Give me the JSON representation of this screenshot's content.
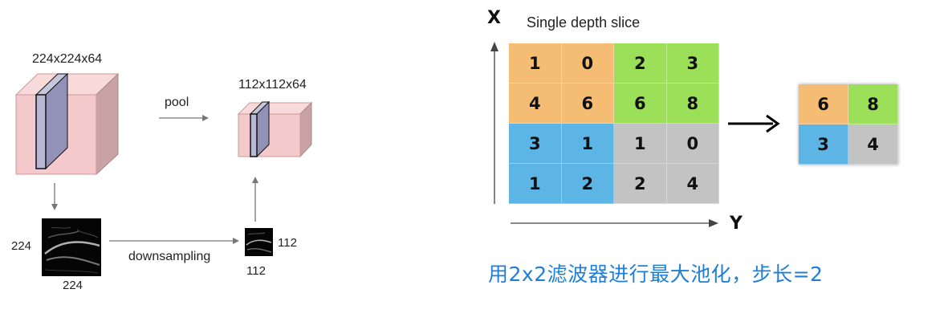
{
  "left_panel": {
    "input_volume_label": "224x224x64",
    "output_volume_label": "112x112x64",
    "pool_label": "pool",
    "downsampling_label": "downsampling",
    "input_slice_height": "224",
    "input_slice_width": "224",
    "output_slice_height": "112",
    "output_slice_width": "112"
  },
  "right_panel": {
    "title": "Single depth slice",
    "x_axis_label": "X",
    "y_axis_label": "Y",
    "input_grid": [
      [
        "1",
        "0",
        "2",
        "3"
      ],
      [
        "4",
        "6",
        "6",
        "8"
      ],
      [
        "3",
        "1",
        "1",
        "0"
      ],
      [
        "1",
        "2",
        "2",
        "4"
      ]
    ],
    "output_grid": [
      [
        "6",
        "8"
      ],
      [
        "3",
        "4"
      ]
    ],
    "caption": "用2x2滤波器进行最大池化，步长=2"
  },
  "colors": {
    "orange": "#f5bd74",
    "green": "#9ce05a",
    "blue": "#5cb5e4",
    "gray": "#c3c3c3",
    "volume_face": "#f3d2d2",
    "caption": "#1f7fd6"
  }
}
